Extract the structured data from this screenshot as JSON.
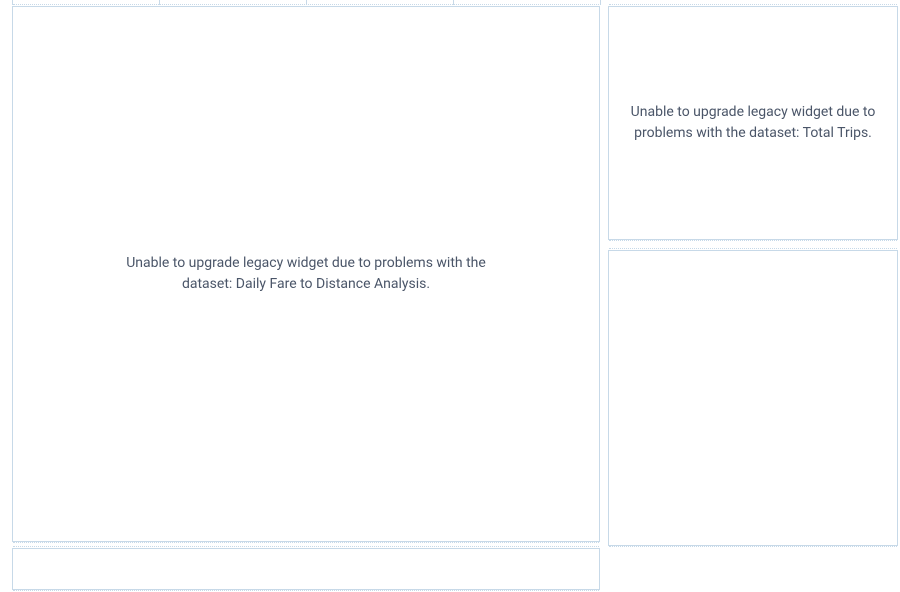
{
  "widgets": {
    "large": {
      "error_message": "Unable to upgrade legacy widget due to problems with the dataset: Daily Fare to Distance Analysis."
    },
    "top_right": {
      "error_message": "Unable to upgrade legacy widget due to problems with the dataset: Total Trips."
    },
    "bottom_right": {
      "error_message": ""
    }
  }
}
